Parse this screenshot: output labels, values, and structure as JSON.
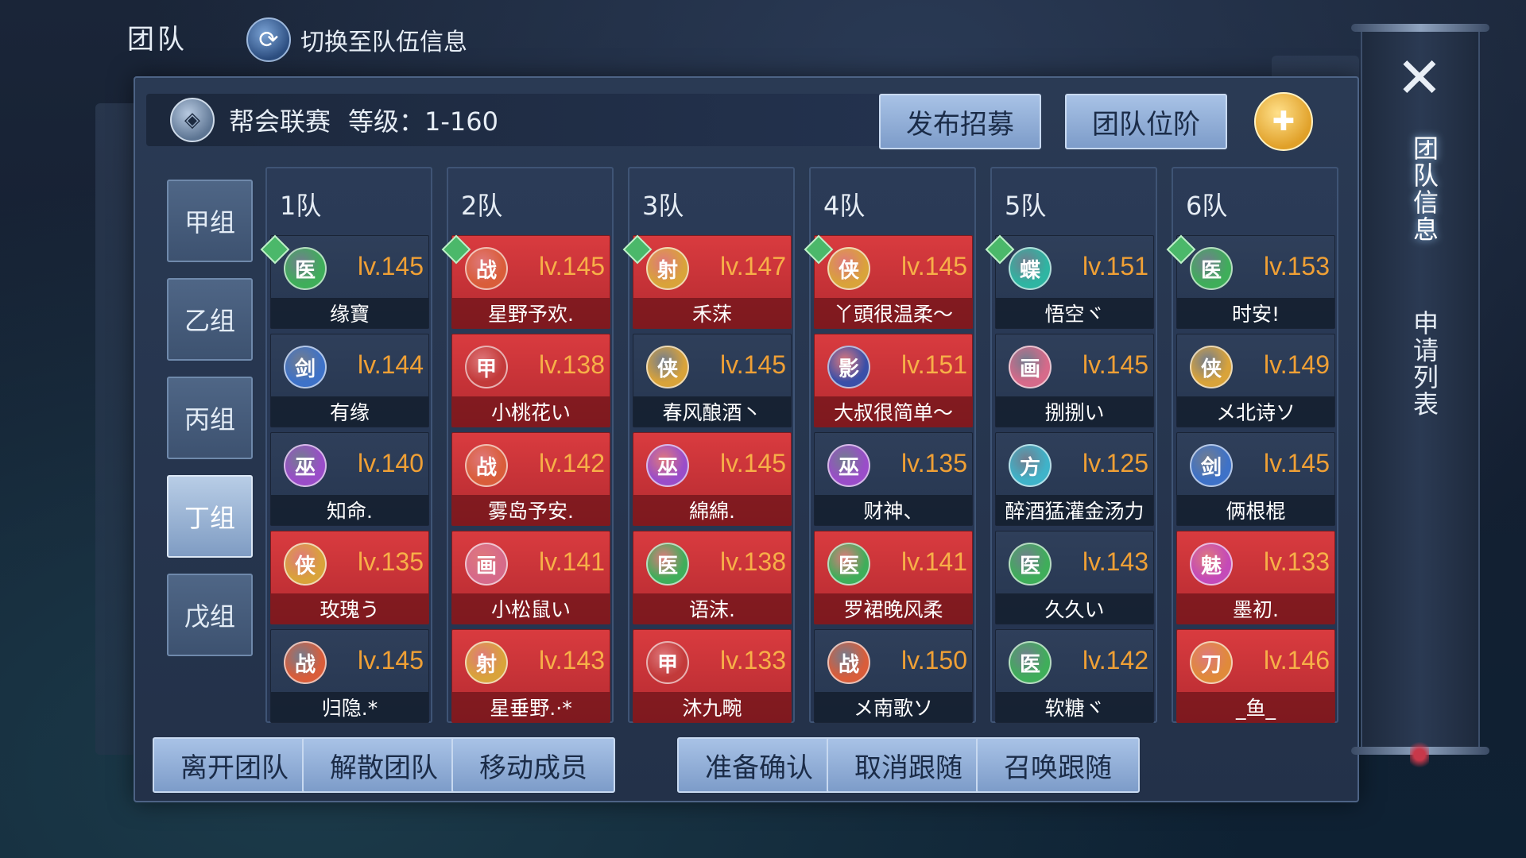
{
  "header": {
    "title": "团队",
    "switch_label": "切换至队伍信息",
    "switch_icon": "refresh-icon"
  },
  "panel": {
    "event_title": "帮会联赛",
    "level_range": "等级：1-160",
    "publish_label": "发布招募",
    "rank_label": "团队位阶",
    "add_icon": "add-member-icon"
  },
  "groups": [
    {
      "label": "甲组",
      "active": false
    },
    {
      "label": "乙组",
      "active": false
    },
    {
      "label": "丙组",
      "active": false
    },
    {
      "label": "丁组",
      "active": true
    },
    {
      "label": "戊组",
      "active": false
    }
  ],
  "teams": [
    {
      "name": "1队",
      "members": [
        {
          "cls": "医",
          "color": "#3fae5a",
          "lv": "lv.145",
          "name": "缘寶",
          "red": false,
          "leader": true
        },
        {
          "cls": "剑",
          "color": "#3e72c8",
          "lv": "lv.144",
          "name": "有缘",
          "red": false,
          "leader": false
        },
        {
          "cls": "巫",
          "color": "#9a4dc9",
          "lv": "lv.140",
          "name": "知命.",
          "red": false,
          "leader": false
        },
        {
          "cls": "侠",
          "color": "#d9a33a",
          "lv": "lv.135",
          "name": "玫瑰う",
          "red": true,
          "leader": false
        },
        {
          "cls": "战",
          "color": "#d95d3a",
          "lv": "lv.145",
          "name": "归隐.*",
          "red": false,
          "leader": false
        }
      ]
    },
    {
      "name": "2队",
      "members": [
        {
          "cls": "战",
          "color": "#d95d3a",
          "lv": "lv.145",
          "name": "星野予欢.",
          "red": true,
          "leader": true
        },
        {
          "cls": "甲",
          "color": "#c23a3a",
          "lv": "lv.138",
          "name": "小桃花い",
          "red": true,
          "leader": false
        },
        {
          "cls": "战",
          "color": "#d95d3a",
          "lv": "lv.142",
          "name": "雾岛予安.",
          "red": true,
          "leader": false
        },
        {
          "cls": "画",
          "color": "#d66a8a",
          "lv": "lv.141",
          "name": "小松鼠い",
          "red": true,
          "leader": false
        },
        {
          "cls": "射",
          "color": "#d9a33a",
          "lv": "lv.143",
          "name": "星垂野.·*",
          "red": true,
          "leader": false
        }
      ]
    },
    {
      "name": "3队",
      "members": [
        {
          "cls": "射",
          "color": "#d9a33a",
          "lv": "lv.147",
          "name": "禾莯",
          "red": true,
          "leader": true
        },
        {
          "cls": "侠",
          "color": "#d9a33a",
          "lv": "lv.145",
          "name": "春风酿酒丶",
          "red": false,
          "leader": false
        },
        {
          "cls": "巫",
          "color": "#9a4dc9",
          "lv": "lv.145",
          "name": "綿綿.",
          "red": true,
          "leader": false
        },
        {
          "cls": "医",
          "color": "#3fae5a",
          "lv": "lv.138",
          "name": "语沫.",
          "red": true,
          "leader": false
        },
        {
          "cls": "甲",
          "color": "#c23a3a",
          "lv": "lv.133",
          "name": "沐九畹",
          "red": true,
          "leader": false
        }
      ]
    },
    {
      "name": "4队",
      "members": [
        {
          "cls": "侠",
          "color": "#d9a33a",
          "lv": "lv.145",
          "name": "丫頭很温柔～",
          "red": true,
          "leader": true
        },
        {
          "cls": "影",
          "color": "#3a4fa8",
          "lv": "lv.151",
          "name": "大叔很简单～",
          "red": true,
          "leader": false
        },
        {
          "cls": "巫",
          "color": "#9a4dc9",
          "lv": "lv.135",
          "name": "财神、",
          "red": false,
          "leader": false
        },
        {
          "cls": "医",
          "color": "#3fae5a",
          "lv": "lv.141",
          "name": "罗裙晚风柔",
          "red": true,
          "leader": false
        },
        {
          "cls": "战",
          "color": "#d95d3a",
          "lv": "lv.150",
          "name": "メ南歌ソ",
          "red": false,
          "leader": false
        }
      ]
    },
    {
      "name": "5队",
      "members": [
        {
          "cls": "蝶",
          "color": "#2fb5a2",
          "lv": "lv.151",
          "name": "悟空ヾ",
          "red": false,
          "leader": true
        },
        {
          "cls": "画",
          "color": "#d66a8a",
          "lv": "lv.145",
          "name": "捌捌い",
          "red": false,
          "leader": false
        },
        {
          "cls": "方",
          "color": "#3fb3c9",
          "lv": "lv.125",
          "name": "醉酒猛灌金汤力",
          "red": false,
          "leader": false
        },
        {
          "cls": "医",
          "color": "#3fae5a",
          "lv": "lv.143",
          "name": "久久い",
          "red": false,
          "leader": false
        },
        {
          "cls": "医",
          "color": "#3fae5a",
          "lv": "lv.142",
          "name": "软糖ヾ",
          "red": false,
          "leader": false
        }
      ]
    },
    {
      "name": "6队",
      "members": [
        {
          "cls": "医",
          "color": "#3fae5a",
          "lv": "lv.153",
          "name": "时安!",
          "red": false,
          "leader": true
        },
        {
          "cls": "侠",
          "color": "#d9a33a",
          "lv": "lv.149",
          "name": "メ北诗ソ",
          "red": false,
          "leader": false
        },
        {
          "cls": "剑",
          "color": "#3e72c8",
          "lv": "lv.145",
          "name": "俩根棍",
          "red": false,
          "leader": false
        },
        {
          "cls": "魅",
          "color": "#c44ab8",
          "lv": "lv.133",
          "name": "墨初.",
          "red": true,
          "leader": false
        },
        {
          "cls": "刀",
          "color": "#e08a3a",
          "lv": "lv.146",
          "name": "_鱼_",
          "red": true,
          "leader": false
        }
      ]
    }
  ],
  "bottom_buttons": [
    {
      "label": "离开团队",
      "name": "leave-team-button"
    },
    {
      "label": "解散团队",
      "name": "disband-team-button"
    },
    {
      "label": "移动成员",
      "name": "move-member-button"
    },
    {
      "label": "准备确认",
      "name": "ready-check-button"
    },
    {
      "label": "取消跟随",
      "name": "cancel-follow-button"
    },
    {
      "label": "召唤跟随",
      "name": "summon-follow-button"
    }
  ],
  "side": {
    "close_icon": "close-icon",
    "tab_team_info": "团队信息",
    "tab_apply_list": "申请列表"
  }
}
